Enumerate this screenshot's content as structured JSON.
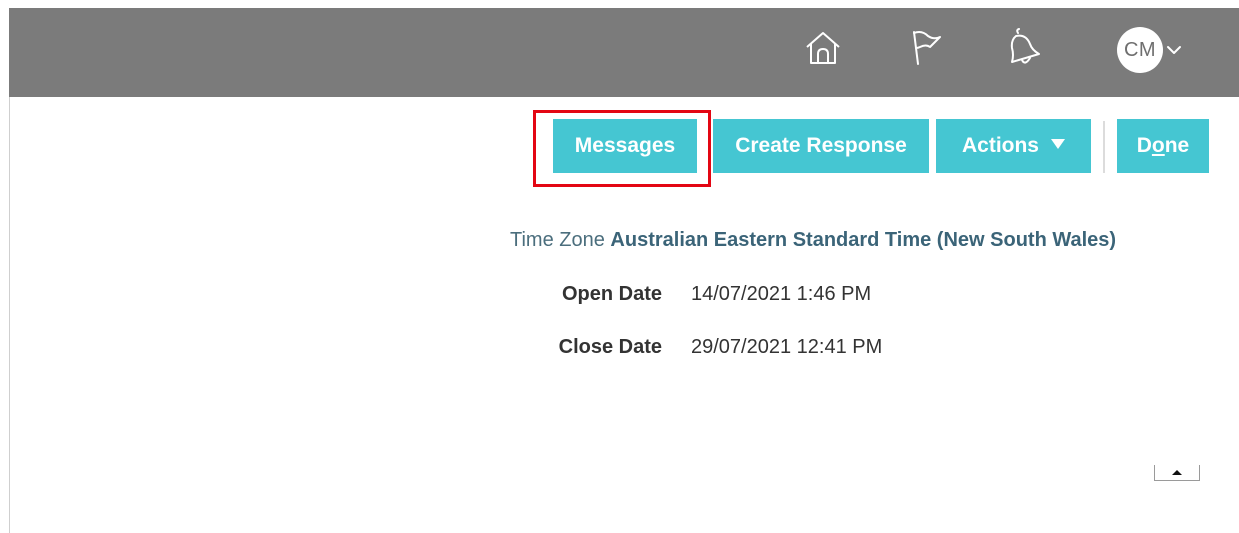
{
  "header": {
    "icons": [
      "home-icon",
      "flag-icon",
      "bell-icon"
    ],
    "avatar_initials": "CM",
    "background_color": "#7b7b7b"
  },
  "toolbar": {
    "messages_label": "Messages",
    "create_response_label": "Create Response",
    "actions_label": "Actions",
    "done_label_pre": "D",
    "done_label_underlined": "o",
    "done_label_post": "ne",
    "button_color": "#45c6d2",
    "highlight_color": "#e30613"
  },
  "details": {
    "time_zone_label": "Time Zone",
    "time_zone_value": "Australian Eastern Standard Time (New South Wales)",
    "open_date_label": "Open Date",
    "open_date_value": "14/07/2021 1:46 PM",
    "close_date_label": "Close Date",
    "close_date_value": "29/07/2021 12:41 PM"
  }
}
